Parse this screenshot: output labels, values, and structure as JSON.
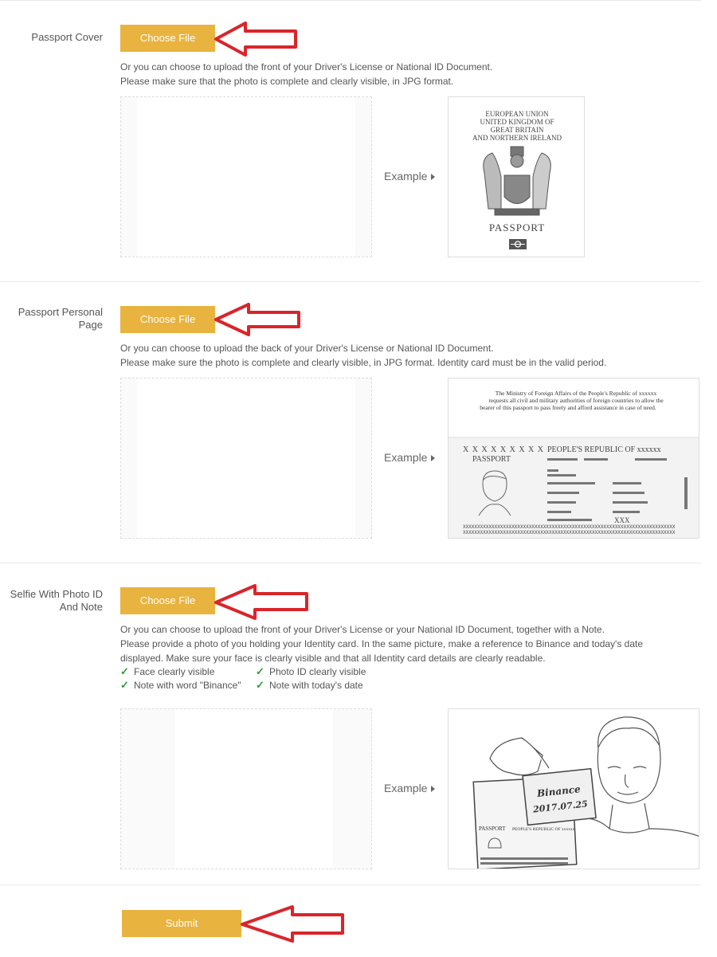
{
  "sections": [
    {
      "label": "Passport Cover",
      "button": "Choose File",
      "lines": [
        "Or you can choose to upload the front of your Driver's License or National ID Document.",
        "Please make sure that the photo is complete and clearly visible, in JPG format."
      ],
      "example": "Example",
      "image_text": {
        "l1": "EUROPEAN UNION",
        "l2": "UNITED KINGDOM OF",
        "l3": "GREAT BRITAIN",
        "l4": "AND NORTHERN IRELAND",
        "title": "PASSPORT"
      }
    },
    {
      "label_line1": "Passport Personal",
      "label_line2": "Page",
      "button": "Choose File",
      "lines": [
        "Or you can choose to upload the back of your Driver's License or National ID Document.",
        "Please make sure the photo is complete and clearly visible, in JPG format. Identity card must be in the valid period."
      ],
      "example": "Example",
      "image_text": {
        "ministry1": "The Ministry of Foreign Affairs of the People's Republic of xxxxxx",
        "ministry2": "requests all civil and military authorities of foreign countries to allow the",
        "ministry3": "bearer of this passport to pass freely and afford assistance in case of need.",
        "xs": "X X X X X X X X X",
        "passport": "PASSPORT",
        "republic": "PEOPLE'S REPUBLIC OF xxxxxx",
        "xxx": "XXX",
        "mrz1": "XXXXXXXXXXXXXXXXXXXXXXXXXXXXXXXXXXXXXXXXXXXXXXXXXXXXXXXXXXXXXXXXXXXXXXXXXX",
        "mrz2": "XXXXXXXXXXXXXXXXXXXXXXXXXXXXXXXXXXXXXXXXXXXXXXXXXXXXXXXXXXXXXXXXXXXXXXXXXX"
      }
    },
    {
      "label_line1": "Selfie With Photo ID",
      "label_line2": "And Note",
      "button": "Choose File",
      "lines": [
        "Or you can choose to upload the front of your Driver's License or your National ID Document, together with a Note.",
        "Please provide a photo of you holding your Identity card. In the same picture, make a reference to Binance and today's date",
        "displayed. Make sure your face is clearly visible and that all Identity card details are clearly readable."
      ],
      "checks": [
        "Face clearly visible",
        "Photo ID clearly visible",
        "Note with word \"Binance\"",
        "Note with today's date"
      ],
      "example": "Example",
      "image_text": {
        "note_word": "Binance",
        "note_date": "2017.07.25",
        "passport": "PASSPORT",
        "republic": "PEOPLE'S REPUBLIC OF xxxxxx"
      }
    }
  ],
  "submit": "Submit",
  "colors": {
    "button": "#e8b33e",
    "arrow": "#d9252b",
    "check": "#2e9c3a"
  }
}
